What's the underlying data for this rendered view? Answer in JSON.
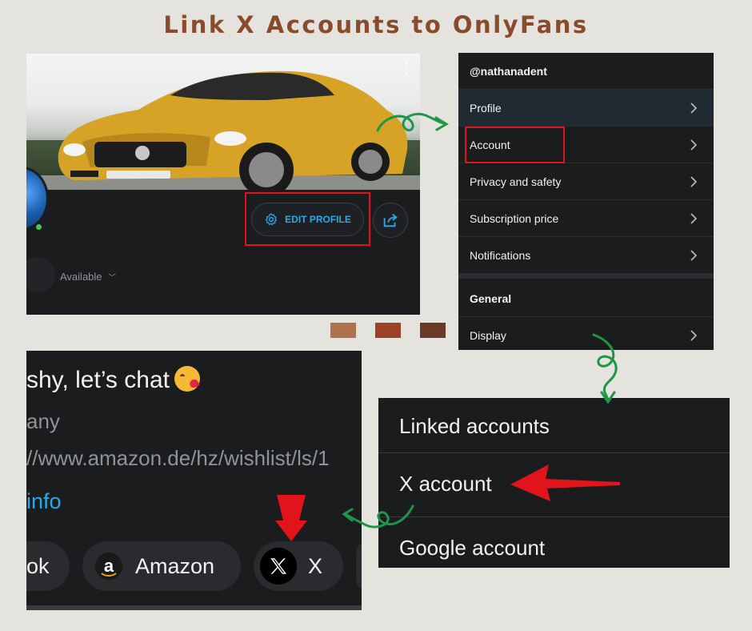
{
  "title": "Link X Accounts to OnlyFans",
  "profile": {
    "edit_button": "EDIT PROFILE",
    "status": "Available"
  },
  "menu": {
    "username": "@nathanadent",
    "items": [
      {
        "label": "Profile"
      },
      {
        "label": "Account"
      },
      {
        "label": "Privacy and safety"
      },
      {
        "label": "Subscription price"
      },
      {
        "label": "Notifications"
      }
    ],
    "general_header": "General",
    "display_item": "Display"
  },
  "bio": {
    "line1": "shy, let’s chat",
    "line2": "any",
    "line3": "//www.amazon.de/hz/wishlist/ls/1",
    "line4": "info",
    "pills": {
      "left_partial": "ok",
      "amazon": "Amazon",
      "amazon_icon": "a",
      "x": "X"
    }
  },
  "linked": {
    "header": "Linked accounts",
    "x_account": "X account",
    "google_account": "Google account"
  },
  "colors": {
    "title": "#8a4a2c",
    "highlight": "#e0141a",
    "accent_blue": "#27a9e6",
    "arrow_green": "#1e9646",
    "swatches": [
      "#b0714f",
      "#9c4124",
      "#6b3a27"
    ]
  }
}
